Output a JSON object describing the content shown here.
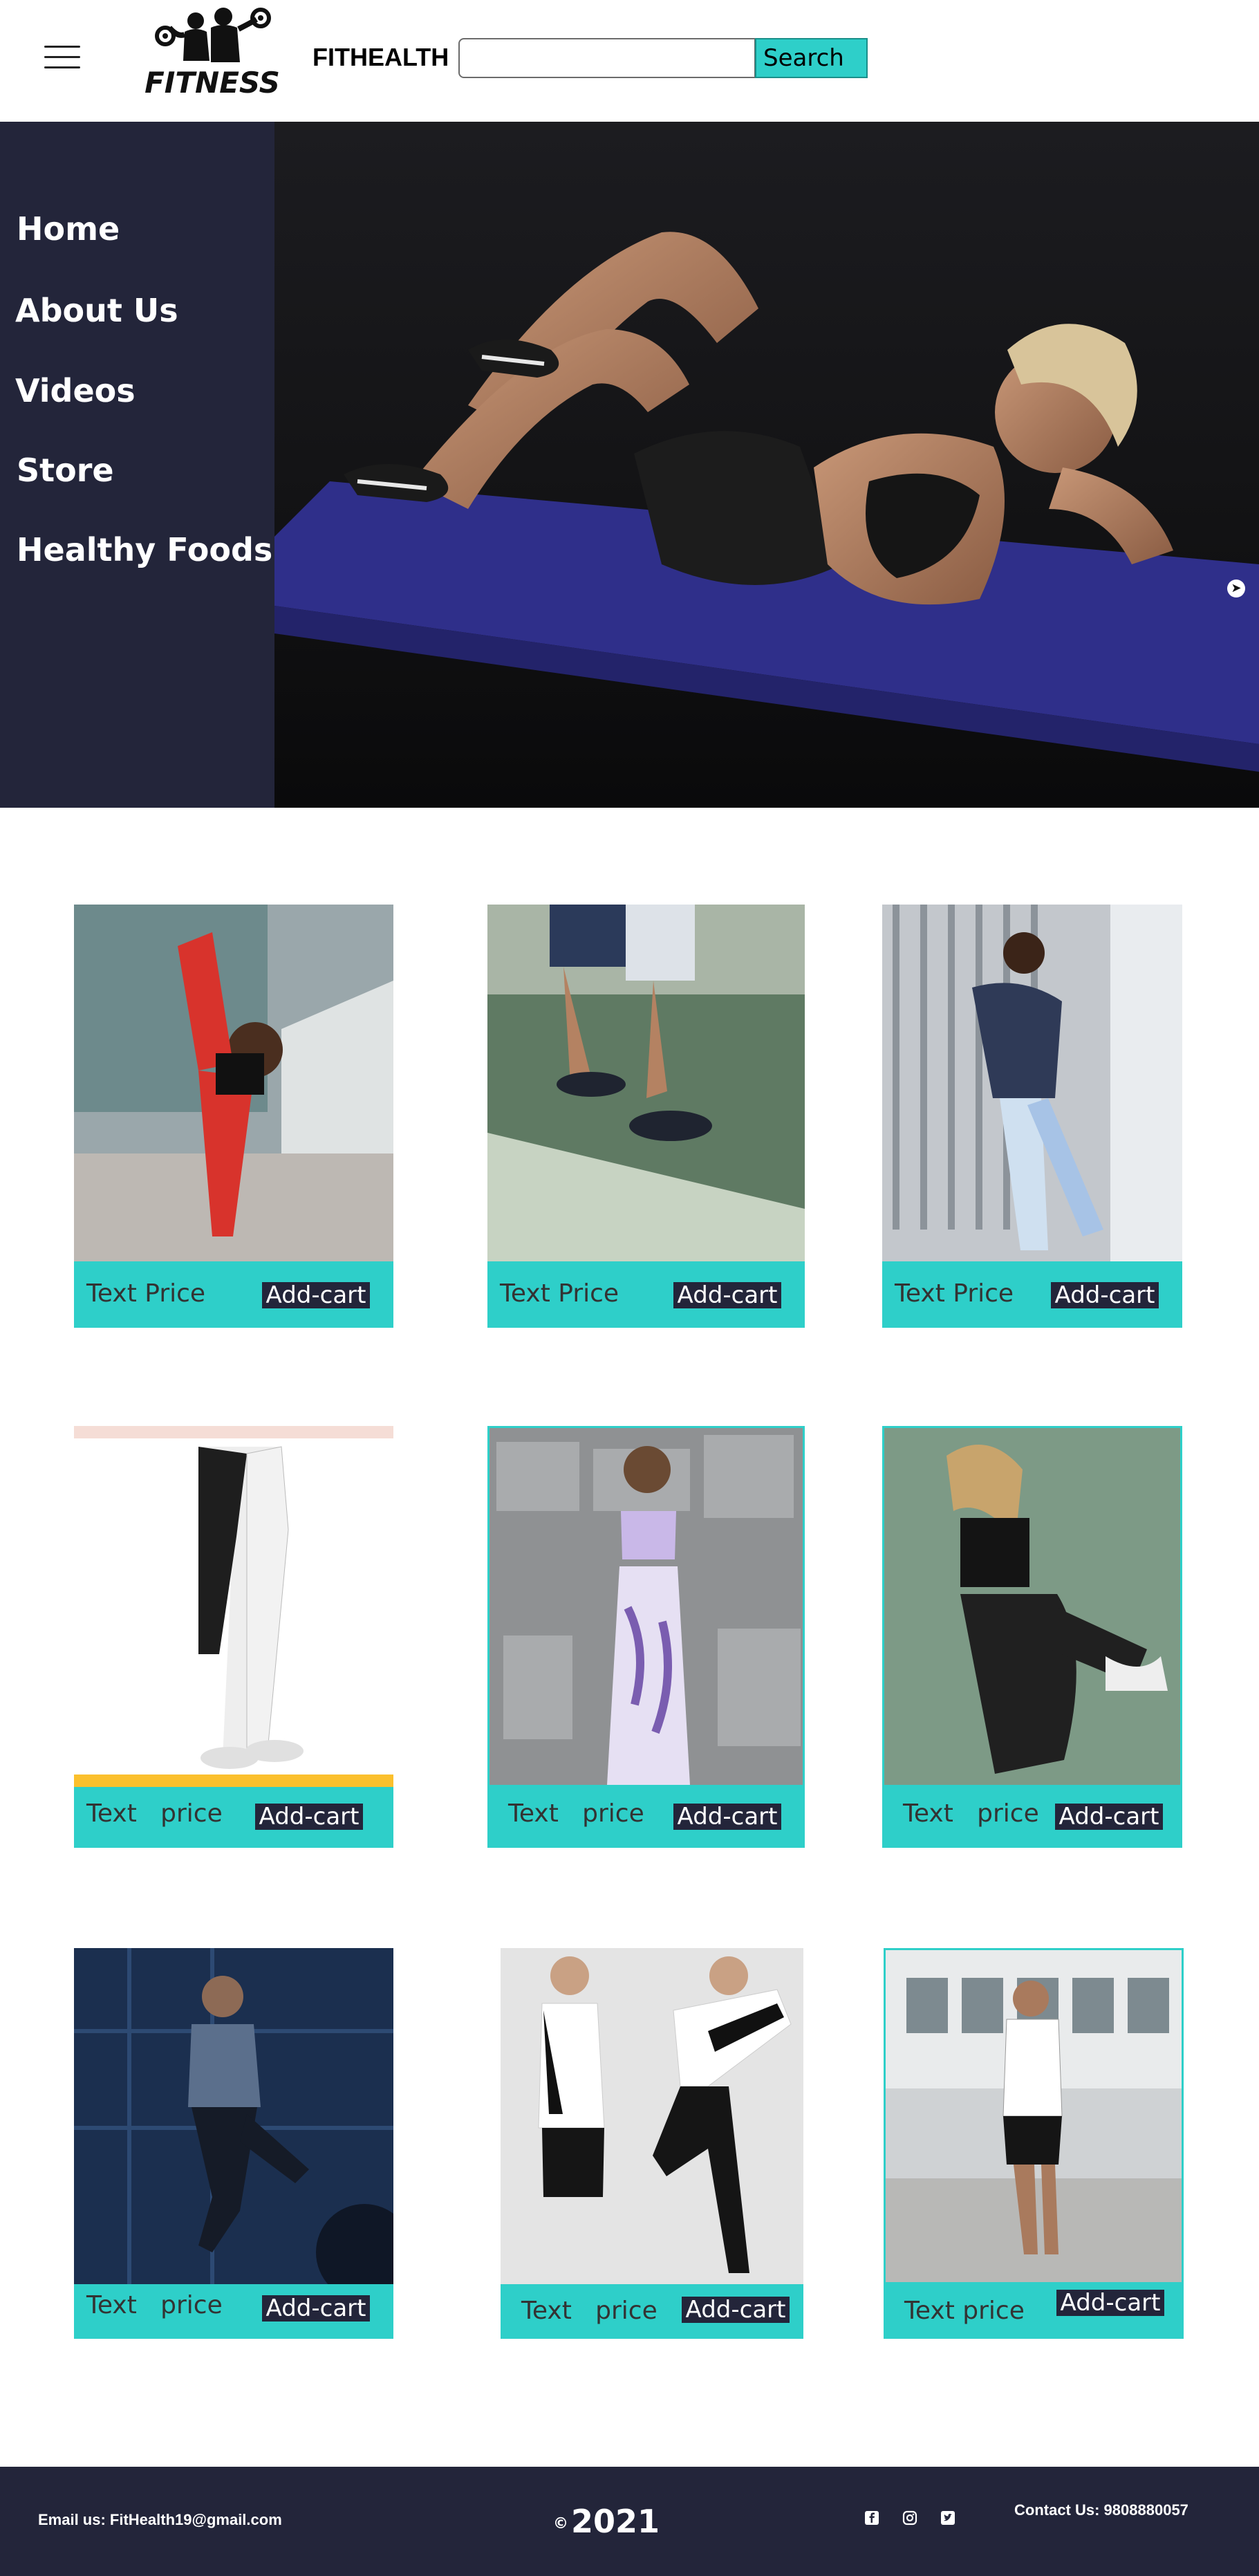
{
  "header": {
    "brand": "FITHEALTH",
    "logo_text": "FITNESS",
    "search": {
      "value": "",
      "placeholder": "",
      "button_label": "Search"
    }
  },
  "sidebar": {
    "items": [
      {
        "label": "Home"
      },
      {
        "label": "About Us"
      },
      {
        "label": "Videos"
      },
      {
        "label": "Store"
      },
      {
        "label": "Healthy Foods"
      }
    ]
  },
  "products": [
    {
      "label": "Text Price",
      "button": "Add-cart"
    },
    {
      "label": "Text Price",
      "button": "Add-cart"
    },
    {
      "label": "Text Price",
      "button": "Add-cart"
    },
    {
      "label": "Text   price",
      "button": "Add-cart"
    },
    {
      "label": "Text   price",
      "button": "Add-cart"
    },
    {
      "label": "Text   price",
      "button": "Add-cart"
    },
    {
      "label": "Text   price",
      "button": "Add-cart"
    },
    {
      "label": "Text   price",
      "button": "Add-cart"
    },
    {
      "label": "Text price",
      "button": "Add-cart"
    }
  ],
  "footer": {
    "email": "Email us: FitHealth19@gmail.com",
    "copyright_symbol": "©",
    "year": "2021",
    "contact": "Contact Us: 9808880057"
  },
  "icons": {
    "menu": "hamburger-icon",
    "hero_next": "arrow-right-circle-icon",
    "social": [
      "facebook-icon",
      "instagram-icon",
      "twitter-icon"
    ]
  },
  "colors": {
    "accent": "#2ecfc9",
    "dark": "#23253a"
  }
}
